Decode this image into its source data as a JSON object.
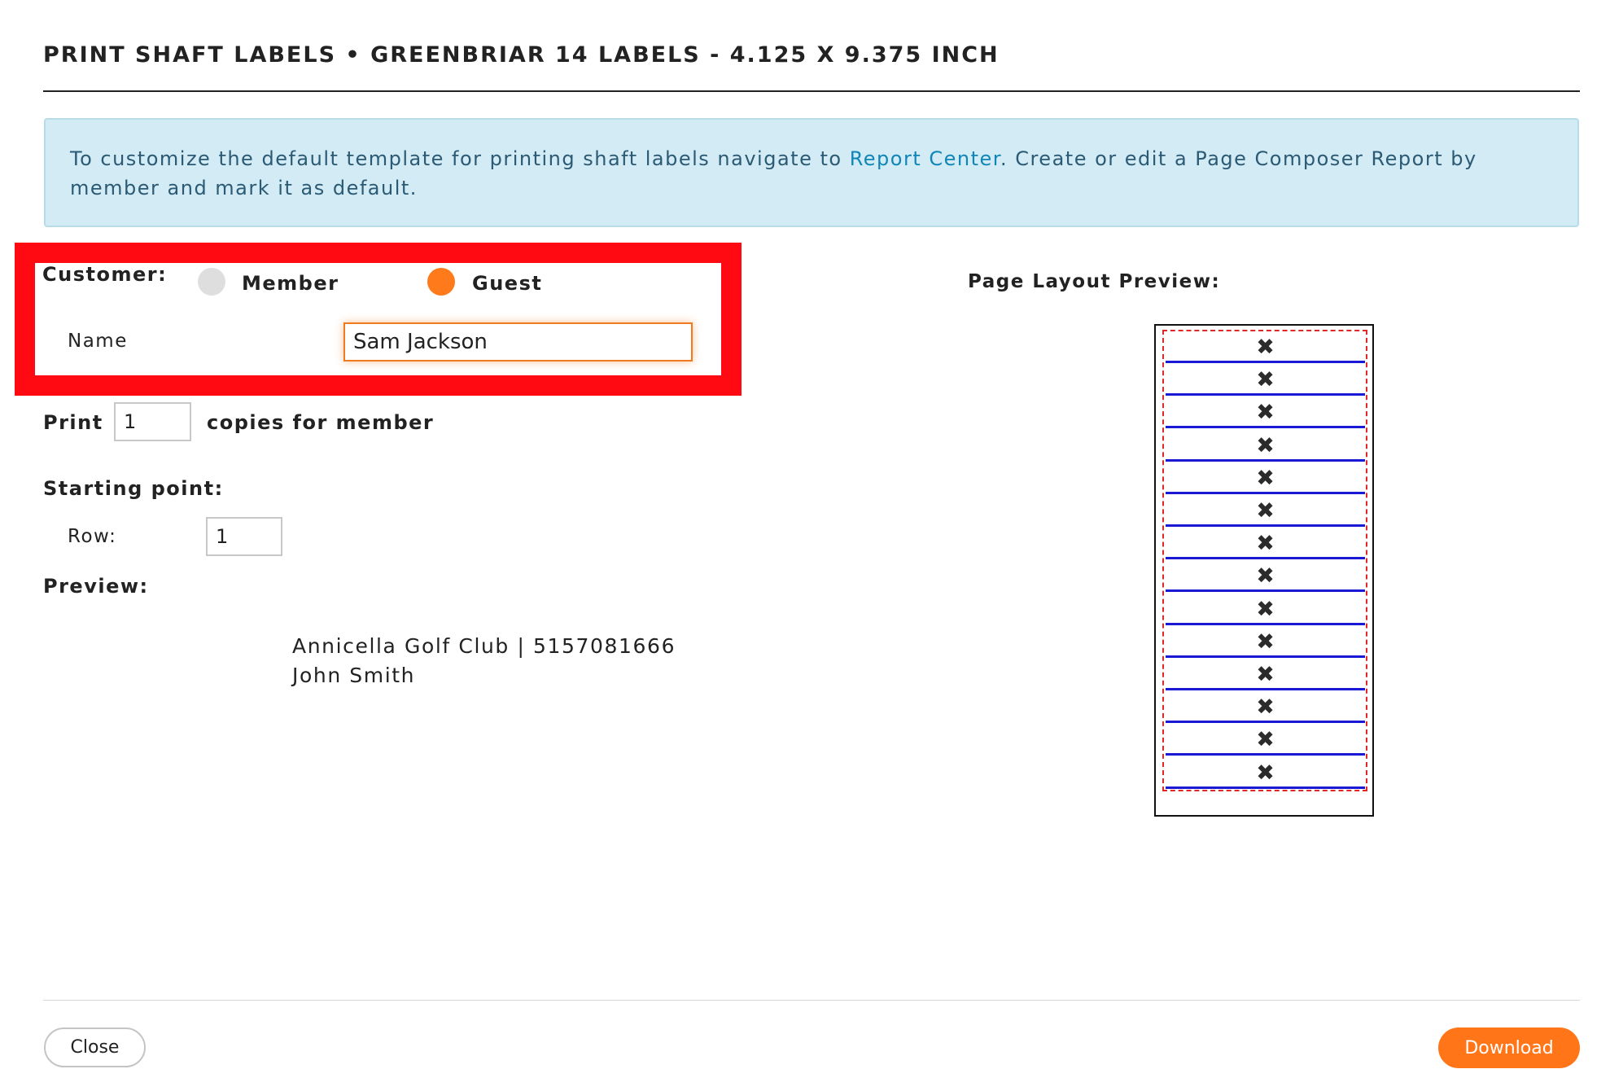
{
  "title": "PRINT SHAFT LABELS • GREENBRIAR 14 LABELS - 4.125 X 9.375 INCH",
  "info": {
    "text_before": "To customize the default template for printing shaft labels navigate to ",
    "link": "Report Center",
    "text_after": ". Create or edit a Page Composer Report by member and mark it as default."
  },
  "customer": {
    "label": "Customer:",
    "options": [
      {
        "label": "Member",
        "selected": false
      },
      {
        "label": "Guest",
        "selected": true
      }
    ],
    "name_label": "Name",
    "name_value": "Sam Jackson"
  },
  "print": {
    "label": "Print",
    "copies": "1",
    "suffix": "copies for member"
  },
  "starting_point": {
    "label": "Starting point:",
    "row_label": "Row:",
    "row_value": "1"
  },
  "preview": {
    "label": "Preview:",
    "lines": [
      "Annicella Golf Club | 5157081666",
      "John Smith"
    ]
  },
  "layout_preview": {
    "label": "Page Layout Preview:",
    "slot_count": 14,
    "slot_mark": "✖"
  },
  "colors": {
    "accent": "#ff7518",
    "highlight": "#ff0a12",
    "info_bg": "#d3ebf5",
    "link": "#0f86b6",
    "slot_line": "#1a1ad6"
  },
  "icons": {
    "slot_mark_icon": "x-mark-icon"
  },
  "buttons": {
    "close": "Close",
    "download": "Download"
  }
}
